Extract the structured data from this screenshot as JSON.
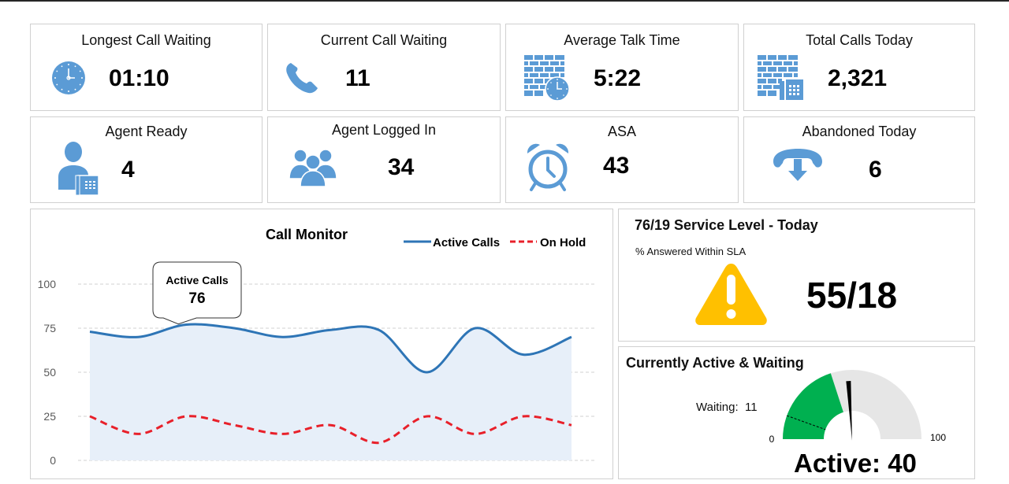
{
  "kpis": [
    {
      "title": "Longest Call Waiting",
      "value": "01:10",
      "icon": "clock-icon"
    },
    {
      "title": "Current Call Waiting",
      "value": "11",
      "icon": "phone-icon"
    },
    {
      "title": "Average Talk Time",
      "value": "5:22",
      "icon": "building-clock-icon"
    },
    {
      "title": "Total Calls Today",
      "value": "2,321",
      "icon": "building-phone-icon"
    },
    {
      "title": "Agent Ready",
      "value": "4",
      "icon": "agent-phone-icon"
    },
    {
      "title": "Agent Logged In",
      "value": "34",
      "icon": "group-icon"
    },
    {
      "title": "ASA",
      "value": "43",
      "icon": "alarm-clock-icon"
    },
    {
      "title": "Abandoned Today",
      "value": "6",
      "icon": "hangup-icon"
    }
  ],
  "service_level": {
    "title": "76/19 Service Level - Today",
    "subtitle": "% Answered Within SLA",
    "value": "55/18",
    "icon": "warning-icon",
    "warning_color": "#FFC000"
  },
  "gauge": {
    "title": "Currently Active & Waiting",
    "waiting_label": "Waiting:  11",
    "active_label": "Active: 40",
    "min_label": "0",
    "max_label": "100",
    "min": 0,
    "max": 100,
    "fill_value": 40,
    "needle_value": 48,
    "waiting_marker_value": 11,
    "fill_color": "#00B050",
    "track_color": "#E6E6E6"
  },
  "colors": {
    "icon_blue": "#5B9BD5",
    "active_line": "#2E75B6",
    "hold_line": "#E8202A",
    "area_fill": "#E7EFF9"
  },
  "chart_data": {
    "type": "line",
    "title": "Call Monitor",
    "xlabel": "",
    "ylabel": "",
    "ylim": [
      0,
      100
    ],
    "yticks": [
      "0",
      "25",
      "50",
      "75",
      "100"
    ],
    "grid": true,
    "legend_position": "top-right",
    "x": [
      1,
      2,
      3,
      4,
      5,
      6,
      7,
      8,
      9,
      10,
      11
    ],
    "series": [
      {
        "name": "Active Calls",
        "style": "solid",
        "area": true,
        "values": [
          73,
          70,
          77,
          75,
          70,
          74,
          74,
          50,
          75,
          60,
          70
        ]
      },
      {
        "name": "On Hold",
        "style": "dashed",
        "values": [
          25,
          15,
          25,
          20,
          15,
          20,
          10,
          25,
          15,
          25,
          20
        ]
      }
    ],
    "annotation": {
      "series": "Active Calls",
      "label": "Active Calls",
      "value": "76",
      "index": 2
    }
  }
}
